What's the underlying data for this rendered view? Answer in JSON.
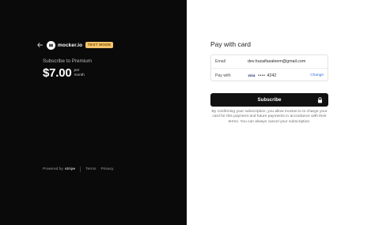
{
  "left_panel": {
    "brand": {
      "name": "mocker.io",
      "badge": "TEST MODE"
    },
    "subscription": {
      "label": "Subscribe to Premium",
      "price": "$7.00",
      "period_line1": "per",
      "period_line2": "month"
    },
    "footer": {
      "powered_prefix": "Powered by",
      "powered_brand": "stripe",
      "terms": "Terms",
      "privacy": "Privacy"
    }
  },
  "right_panel": {
    "title": "Pay with card",
    "email": {
      "label": "Email",
      "value": "dev.huzaifasaleem@gmail.com"
    },
    "pay_with": {
      "label": "Pay with",
      "card_brand": "VISA",
      "masked": "••••",
      "last4": "4242",
      "change": "Change"
    },
    "subscribe_button": "Subscribe",
    "consent": "By confirming your subscription, you allow mocker.io to charge your card for this payment and future payments in accordance with their terms. You can always cancel your subscription."
  },
  "colors": {
    "left_bg": "#0a0a0a",
    "right_bg": "#ffffff",
    "badge_bg": "#f5c46b",
    "link": "#2f6fd6",
    "button_bg": "#111111"
  }
}
